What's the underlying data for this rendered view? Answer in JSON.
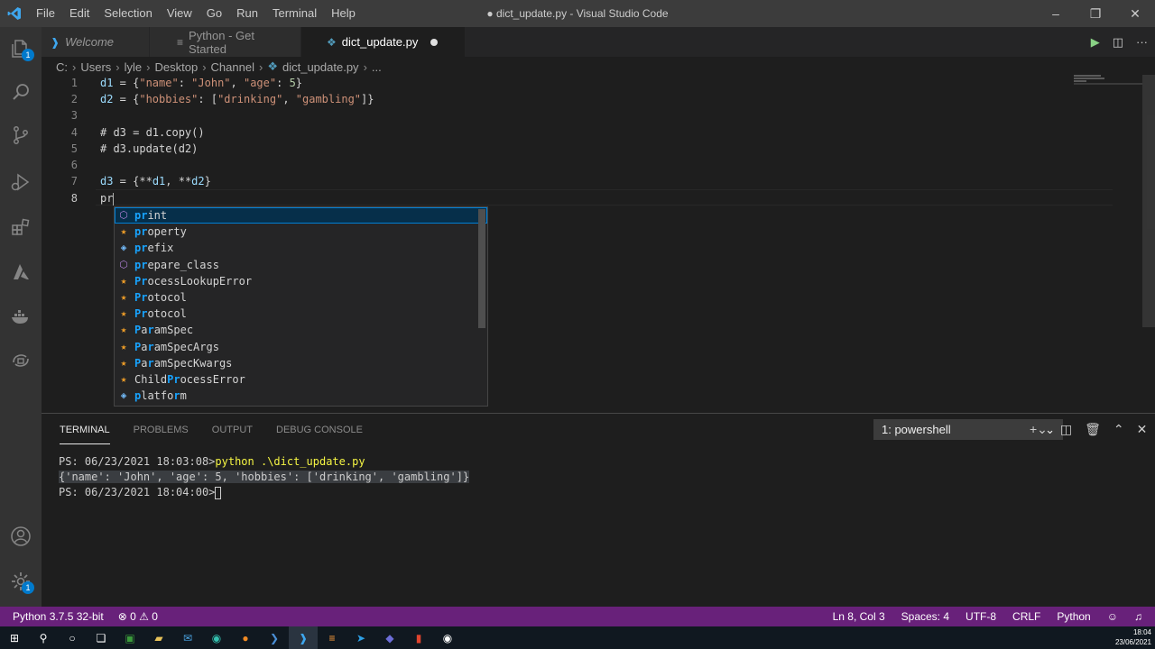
{
  "window": {
    "title": "● dict_update.py - Visual Studio Code",
    "menu": [
      "File",
      "Edit",
      "Selection",
      "View",
      "Go",
      "Run",
      "Terminal",
      "Help"
    ]
  },
  "tabs": [
    {
      "label": "Welcome",
      "icon": "vscode-icon"
    },
    {
      "label": "Python - Get Started",
      "icon": "list-icon"
    },
    {
      "label": "dict_update.py",
      "icon": "python-icon",
      "active": true,
      "modified": true
    }
  ],
  "breadcrumb": [
    "C:",
    "Users",
    "lyle",
    "Desktop",
    "Channel",
    "dict_update.py",
    "..."
  ],
  "editor": {
    "lines": [
      "1",
      "2",
      "3",
      "4",
      "5",
      "6",
      "7",
      "8"
    ],
    "current_line": "8"
  },
  "suggest": {
    "typed": "pr",
    "items": [
      {
        "label": "print",
        "kind": "method-icon"
      },
      {
        "label": "property",
        "kind": "class-icon"
      },
      {
        "label": "prefix",
        "kind": "variable-icon"
      },
      {
        "label": "prepare_class",
        "kind": "method-icon"
      },
      {
        "label": "ProcessLookupError",
        "kind": "class-icon"
      },
      {
        "label": "Protocol",
        "kind": "class-icon"
      },
      {
        "label": "Protocol",
        "kind": "class-icon"
      },
      {
        "label": "ParamSpec",
        "kind": "class-icon"
      },
      {
        "label": "ParamSpecArgs",
        "kind": "class-icon"
      },
      {
        "label": "ParamSpecKwargs",
        "kind": "class-icon"
      },
      {
        "label": "ChildProcessError",
        "kind": "class-icon"
      },
      {
        "label": "platform",
        "kind": "variable-icon"
      }
    ]
  },
  "panel": {
    "tabs": [
      "TERMINAL",
      "PROBLEMS",
      "OUTPUT",
      "DEBUG CONSOLE"
    ],
    "terminal_selector": "1: powershell",
    "terminal_lines": [
      {
        "prompt": "PS: 06/23/2021 18:03:08>",
        "command": "python .\\dict_update.py"
      },
      {
        "output": "{'name': 'John', 'age': 5, 'hobbies': ['drinking', 'gambling']}"
      },
      {
        "prompt": "PS: 06/23/2021 18:04:00>"
      }
    ]
  },
  "status": {
    "interpreter": "Python 3.7.5 32-bit",
    "errors": "0",
    "warnings": "0",
    "position": "Ln 8, Col 3",
    "spaces": "Spaces: 4",
    "encoding": "UTF-8",
    "eol": "CRLF",
    "language": "Python"
  },
  "taskbar": {
    "time": "18:04",
    "date": "23/06/2021"
  },
  "colors": {
    "status_bar": "#68217a",
    "title_bar": "#3c3c3c",
    "activity_bar": "#333333",
    "editor_bg": "#1e1e1e",
    "suggest_highlight": "#18a3ff",
    "badge": "#007acc"
  }
}
